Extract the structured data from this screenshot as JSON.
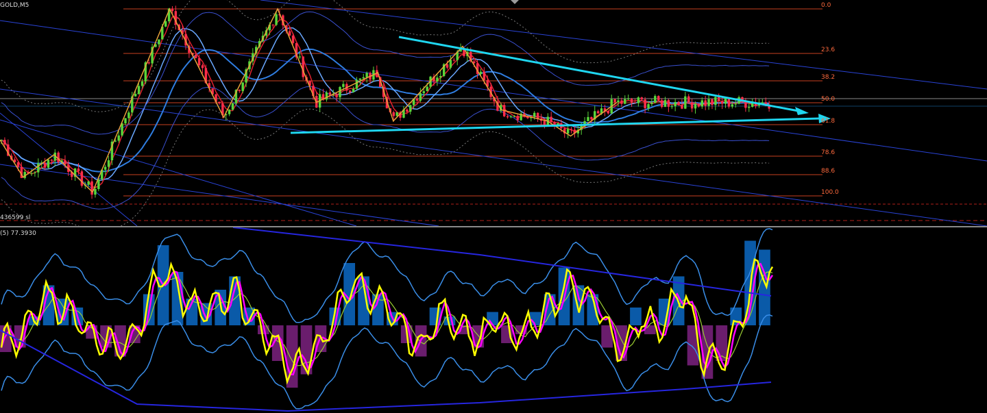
{
  "chart": {
    "symbol_label": "GOLD,M5",
    "sl_label": "436599 sl",
    "oscillator_label": "(5) 77.3930"
  },
  "fib_levels": [
    "0.0",
    "23.6",
    "38.2",
    "50.0",
    "61.8",
    "78.6",
    "88.6",
    "100.0"
  ],
  "colors": {
    "background": "#000000",
    "bull_candle": "#59d63a",
    "bear_candle": "#ff2d4a",
    "fib_line": "#c8401f",
    "fib_label": "#ff6a3d",
    "trendline": "#1fd6f0",
    "zigzag": "#e8a23a",
    "oscillator_main": "#ffff00",
    "oscillator_signal": "#ff00ff",
    "oscillator_slow": "#9acd32",
    "histogram_up": "#0a5aa8",
    "histogram_down": "#6a1d6d",
    "band": "#3a8ee8"
  },
  "chart_data": [
    {
      "type": "candlestick",
      "title": "GOLD,M5",
      "fib_retracement": [
        0.0,
        23.6,
        38.2,
        50.0,
        61.8,
        78.6,
        88.6,
        100.0
      ],
      "swing_points_pct_of_range": [
        [
          0.0,
          0.3
        ],
        [
          0.03,
          0.1
        ],
        [
          0.07,
          0.22
        ],
        [
          0.12,
          0.02
        ],
        [
          0.22,
          1.0
        ],
        [
          0.29,
          0.42
        ],
        [
          0.36,
          1.0
        ],
        [
          0.41,
          0.5
        ],
        [
          0.49,
          0.66
        ],
        [
          0.51,
          0.4
        ],
        [
          0.6,
          0.8
        ],
        [
          0.65,
          0.46
        ],
        [
          0.71,
          0.4
        ],
        [
          0.74,
          0.32
        ],
        [
          0.8,
          0.5
        ]
      ],
      "trendlines": [
        "descending resistance",
        "flat support"
      ],
      "grid": false
    },
    {
      "type": "oscillator",
      "label": "(5) 77.3930",
      "value": 77.393,
      "histogram_pct": [
        -0.3,
        -0.25,
        0.1,
        0.45,
        0.3,
        0.2,
        -0.15,
        -0.25,
        -0.35,
        -0.2,
        0.35,
        0.9,
        0.6,
        0.3,
        0.25,
        0.4,
        0.55,
        0.2,
        -0.1,
        -0.4,
        -0.7,
        -0.55,
        -0.3,
        0.2,
        0.7,
        0.55,
        0.35,
        0.15,
        -0.2,
        -0.35,
        0.2,
        0.1,
        -0.1,
        -0.25,
        0.15,
        -0.2,
        -0.1,
        0.15,
        0.35,
        0.65,
        0.45,
        0.35,
        -0.25,
        -0.4,
        0.2,
        -0.1,
        0.3,
        0.55,
        -0.45,
        -0.6,
        -0.4,
        0.2,
        0.95,
        0.85
      ]
    }
  ]
}
